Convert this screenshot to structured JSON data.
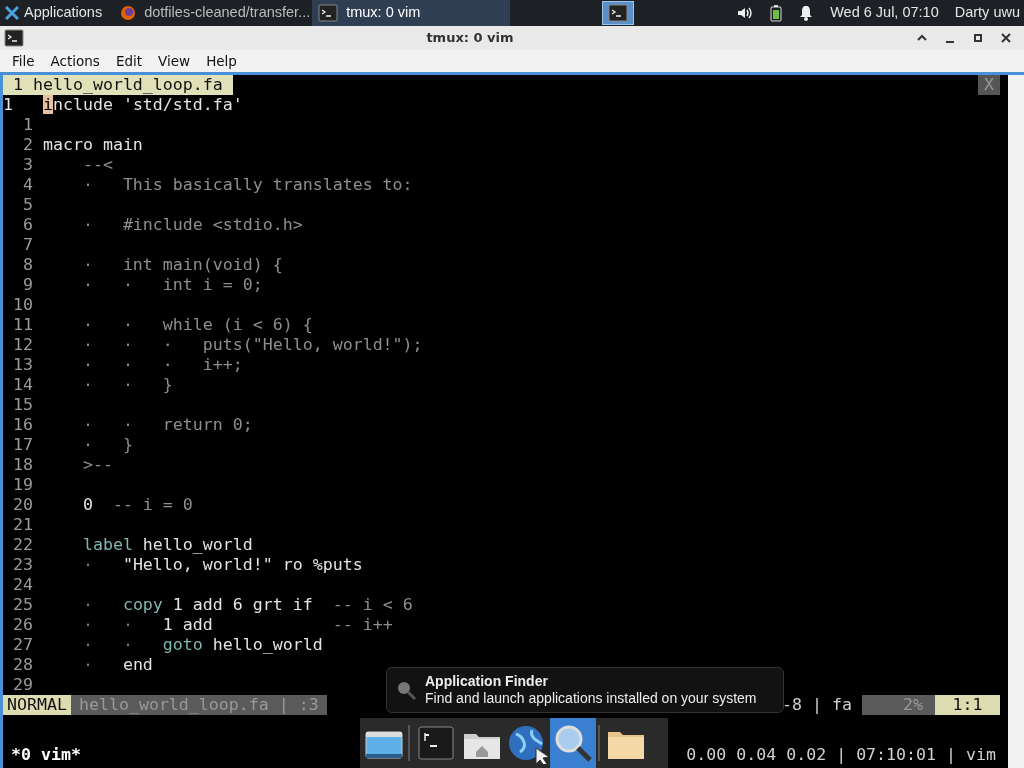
{
  "panel": {
    "apps_menu": "Applications",
    "tasks": [
      {
        "title": "dotfiles-cleaned/transfer...",
        "kind": "browser",
        "selected": false
      },
      {
        "title": "tmux: 0 vim",
        "kind": "terminal",
        "selected": true
      }
    ],
    "clock": "Wed  6 Jul, 07:10",
    "user": "Darty uwu"
  },
  "window": {
    "title": "tmux: 0 vim",
    "menu": [
      "File",
      "Actions",
      "Edit",
      "View",
      "Help"
    ]
  },
  "vim": {
    "tabs": [
      {
        "label": "1 hello_world_loop.fa",
        "selected": true
      }
    ],
    "close_label": "X",
    "lines": [
      {
        "number": "1",
        "current": true,
        "segments": [
          {
            "text": "i",
            "kind": "cursor"
          },
          {
            "text": "nclude 'std/std.fa'",
            "kind": "plain"
          }
        ]
      },
      {
        "number": "1",
        "current": false
      },
      {
        "number": "2",
        "current": false,
        "segments": [
          {
            "text": "macro main",
            "kind": "plain"
          }
        ]
      },
      {
        "number": "3",
        "current": false,
        "segments": [
          {
            "text": "    --<",
            "kind": "comment"
          }
        ]
      },
      {
        "number": "4",
        "current": false,
        "segments": [
          {
            "text": "    ·   This basically translates to:",
            "kind": "comment"
          }
        ]
      },
      {
        "number": "5",
        "current": false
      },
      {
        "number": "6",
        "current": false,
        "segments": [
          {
            "text": "    ·   #include <stdio.h>",
            "kind": "comment"
          }
        ]
      },
      {
        "number": "7",
        "current": false
      },
      {
        "number": "8",
        "current": false,
        "segments": [
          {
            "text": "    ·   int main(void) {",
            "kind": "comment"
          }
        ]
      },
      {
        "number": "9",
        "current": false,
        "segments": [
          {
            "text": "    ·   ·   int i = 0;",
            "kind": "comment"
          }
        ]
      },
      {
        "number": "10",
        "current": false
      },
      {
        "number": "11",
        "current": false,
        "segments": [
          {
            "text": "    ·   ·   while (i < 6) {",
            "kind": "comment"
          }
        ]
      },
      {
        "number": "12",
        "current": false,
        "segments": [
          {
            "text": "    ·   ·   ·   puts(\"Hello, world!\");",
            "kind": "comment"
          }
        ]
      },
      {
        "number": "13",
        "current": false,
        "segments": [
          {
            "text": "    ·   ·   ·   i++;",
            "kind": "comment"
          }
        ]
      },
      {
        "number": "14",
        "current": false,
        "segments": [
          {
            "text": "    ·   ·   }",
            "kind": "comment"
          }
        ]
      },
      {
        "number": "15",
        "current": false
      },
      {
        "number": "16",
        "current": false,
        "segments": [
          {
            "text": "    ·   ·   return 0;",
            "kind": "comment"
          }
        ]
      },
      {
        "number": "17",
        "current": false,
        "segments": [
          {
            "text": "    ·   }",
            "kind": "comment"
          }
        ]
      },
      {
        "number": "18",
        "current": false,
        "segments": [
          {
            "text": "    >--",
            "kind": "comment"
          }
        ]
      },
      {
        "number": "19",
        "current": false
      },
      {
        "number": "20",
        "current": false,
        "segments": [
          {
            "text": "    0  ",
            "kind": "plain"
          },
          {
            "text": "-- i = 0",
            "kind": "comment"
          }
        ]
      },
      {
        "number": "21",
        "current": false
      },
      {
        "number": "22",
        "current": false,
        "segments": [
          {
            "text": "    label",
            "kind": "keyword"
          },
          {
            "text": " hello_world",
            "kind": "plain"
          }
        ]
      },
      {
        "number": "23",
        "current": false,
        "segments": [
          {
            "text": "    ·   ",
            "kind": "guide"
          },
          {
            "text": "\"Hello, world!\" ro %puts",
            "kind": "plain"
          }
        ]
      },
      {
        "number": "24",
        "current": false
      },
      {
        "number": "25",
        "current": false,
        "segments": [
          {
            "text": "    ·   ",
            "kind": "guide"
          },
          {
            "text": "copy",
            "kind": "keyword"
          },
          {
            "text": " 1 add 6 grt if  ",
            "kind": "plain"
          },
          {
            "text": "-- i < 6",
            "kind": "comment"
          }
        ]
      },
      {
        "number": "26",
        "current": false,
        "segments": [
          {
            "text": "    ·   ·   ",
            "kind": "guide"
          },
          {
            "text": "1 add            ",
            "kind": "plain"
          },
          {
            "text": "-- i++",
            "kind": "comment"
          }
        ]
      },
      {
        "number": "27",
        "current": false,
        "segments": [
          {
            "text": "    ·   ·   ",
            "kind": "guide"
          },
          {
            "text": "goto",
            "kind": "keyword"
          },
          {
            "text": " hello_world",
            "kind": "plain"
          }
        ]
      },
      {
        "number": "28",
        "current": false,
        "segments": [
          {
            "text": "    ·   ",
            "kind": "guide"
          },
          {
            "text": "end",
            "kind": "plain"
          }
        ]
      },
      {
        "number": "29",
        "current": false
      }
    ],
    "statusline": {
      "mode": "NORMAL",
      "file": "hello_world_loop.fa | :3",
      "info": "-8 | fa",
      "percent": "2%",
      "position": "1:1"
    }
  },
  "tmux": {
    "window_list": "*0 vim*",
    "status_right": "0.00 0.04 0.02 | 07:10:01 | vim"
  },
  "dock": {
    "items": [
      {
        "kind": "desktop",
        "selected": false
      },
      {
        "kind": "terminal",
        "selected": false
      },
      {
        "kind": "home",
        "selected": false
      },
      {
        "kind": "globe",
        "selected": false
      },
      {
        "kind": "search",
        "selected": true
      },
      {
        "kind": "folder",
        "selected": false
      }
    ]
  },
  "tooltip": {
    "title": "Application Finder",
    "description": "Find and launch applications installed on your system"
  }
}
